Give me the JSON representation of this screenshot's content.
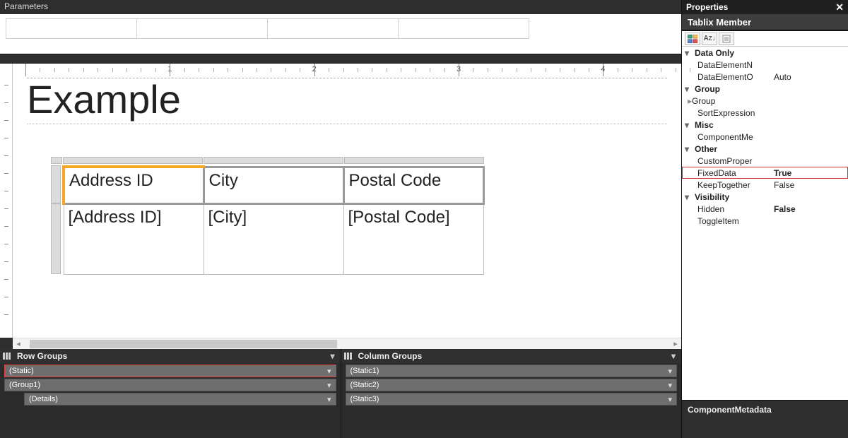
{
  "parameters": {
    "title": "Parameters"
  },
  "ruler": {
    "labels": [
      "1",
      "2",
      "3",
      "4"
    ]
  },
  "report": {
    "title": "Example",
    "tablix": {
      "headers": [
        "Address ID",
        "City",
        "Postal Code"
      ],
      "fields": [
        "[Address ID]",
        "[City]",
        "[Postal Code]"
      ]
    }
  },
  "groups": {
    "rowTitle": "Row Groups",
    "colTitle": "Column Groups",
    "rows": [
      {
        "label": "(Static)",
        "indent": 0,
        "selected": true
      },
      {
        "label": "(Group1)",
        "indent": 0,
        "selected": false
      },
      {
        "label": "(Details)",
        "indent": 2,
        "selected": false
      }
    ],
    "cols": [
      {
        "label": "(Static1)"
      },
      {
        "label": "(Static2)"
      },
      {
        "label": "(Static3)"
      }
    ]
  },
  "properties": {
    "title": "Properties",
    "object": "Tablix Member",
    "footer": "ComponentMetadata",
    "categories": [
      {
        "name": "Data Only",
        "open": true,
        "items": [
          {
            "name": "DataElementN",
            "value": ""
          },
          {
            "name": "DataElementO",
            "value": "Auto"
          }
        ]
      },
      {
        "name": "Group",
        "open": true,
        "items": [
          {
            "name": "Group",
            "value": "",
            "chev": "right"
          },
          {
            "name": "SortExpression",
            "value": ""
          }
        ]
      },
      {
        "name": "Misc",
        "open": true,
        "items": [
          {
            "name": "ComponentMe",
            "value": ""
          }
        ]
      },
      {
        "name": "Other",
        "open": true,
        "items": [
          {
            "name": "CustomProper",
            "value": ""
          },
          {
            "name": "FixedData",
            "value": "True",
            "bold": true,
            "highlight": true
          },
          {
            "name": "KeepTogether",
            "value": "False"
          }
        ]
      },
      {
        "name": "Visibility",
        "open": true,
        "items": [
          {
            "name": "Hidden",
            "value": "False",
            "bold": true
          },
          {
            "name": "ToggleItem",
            "value": ""
          }
        ]
      }
    ]
  }
}
